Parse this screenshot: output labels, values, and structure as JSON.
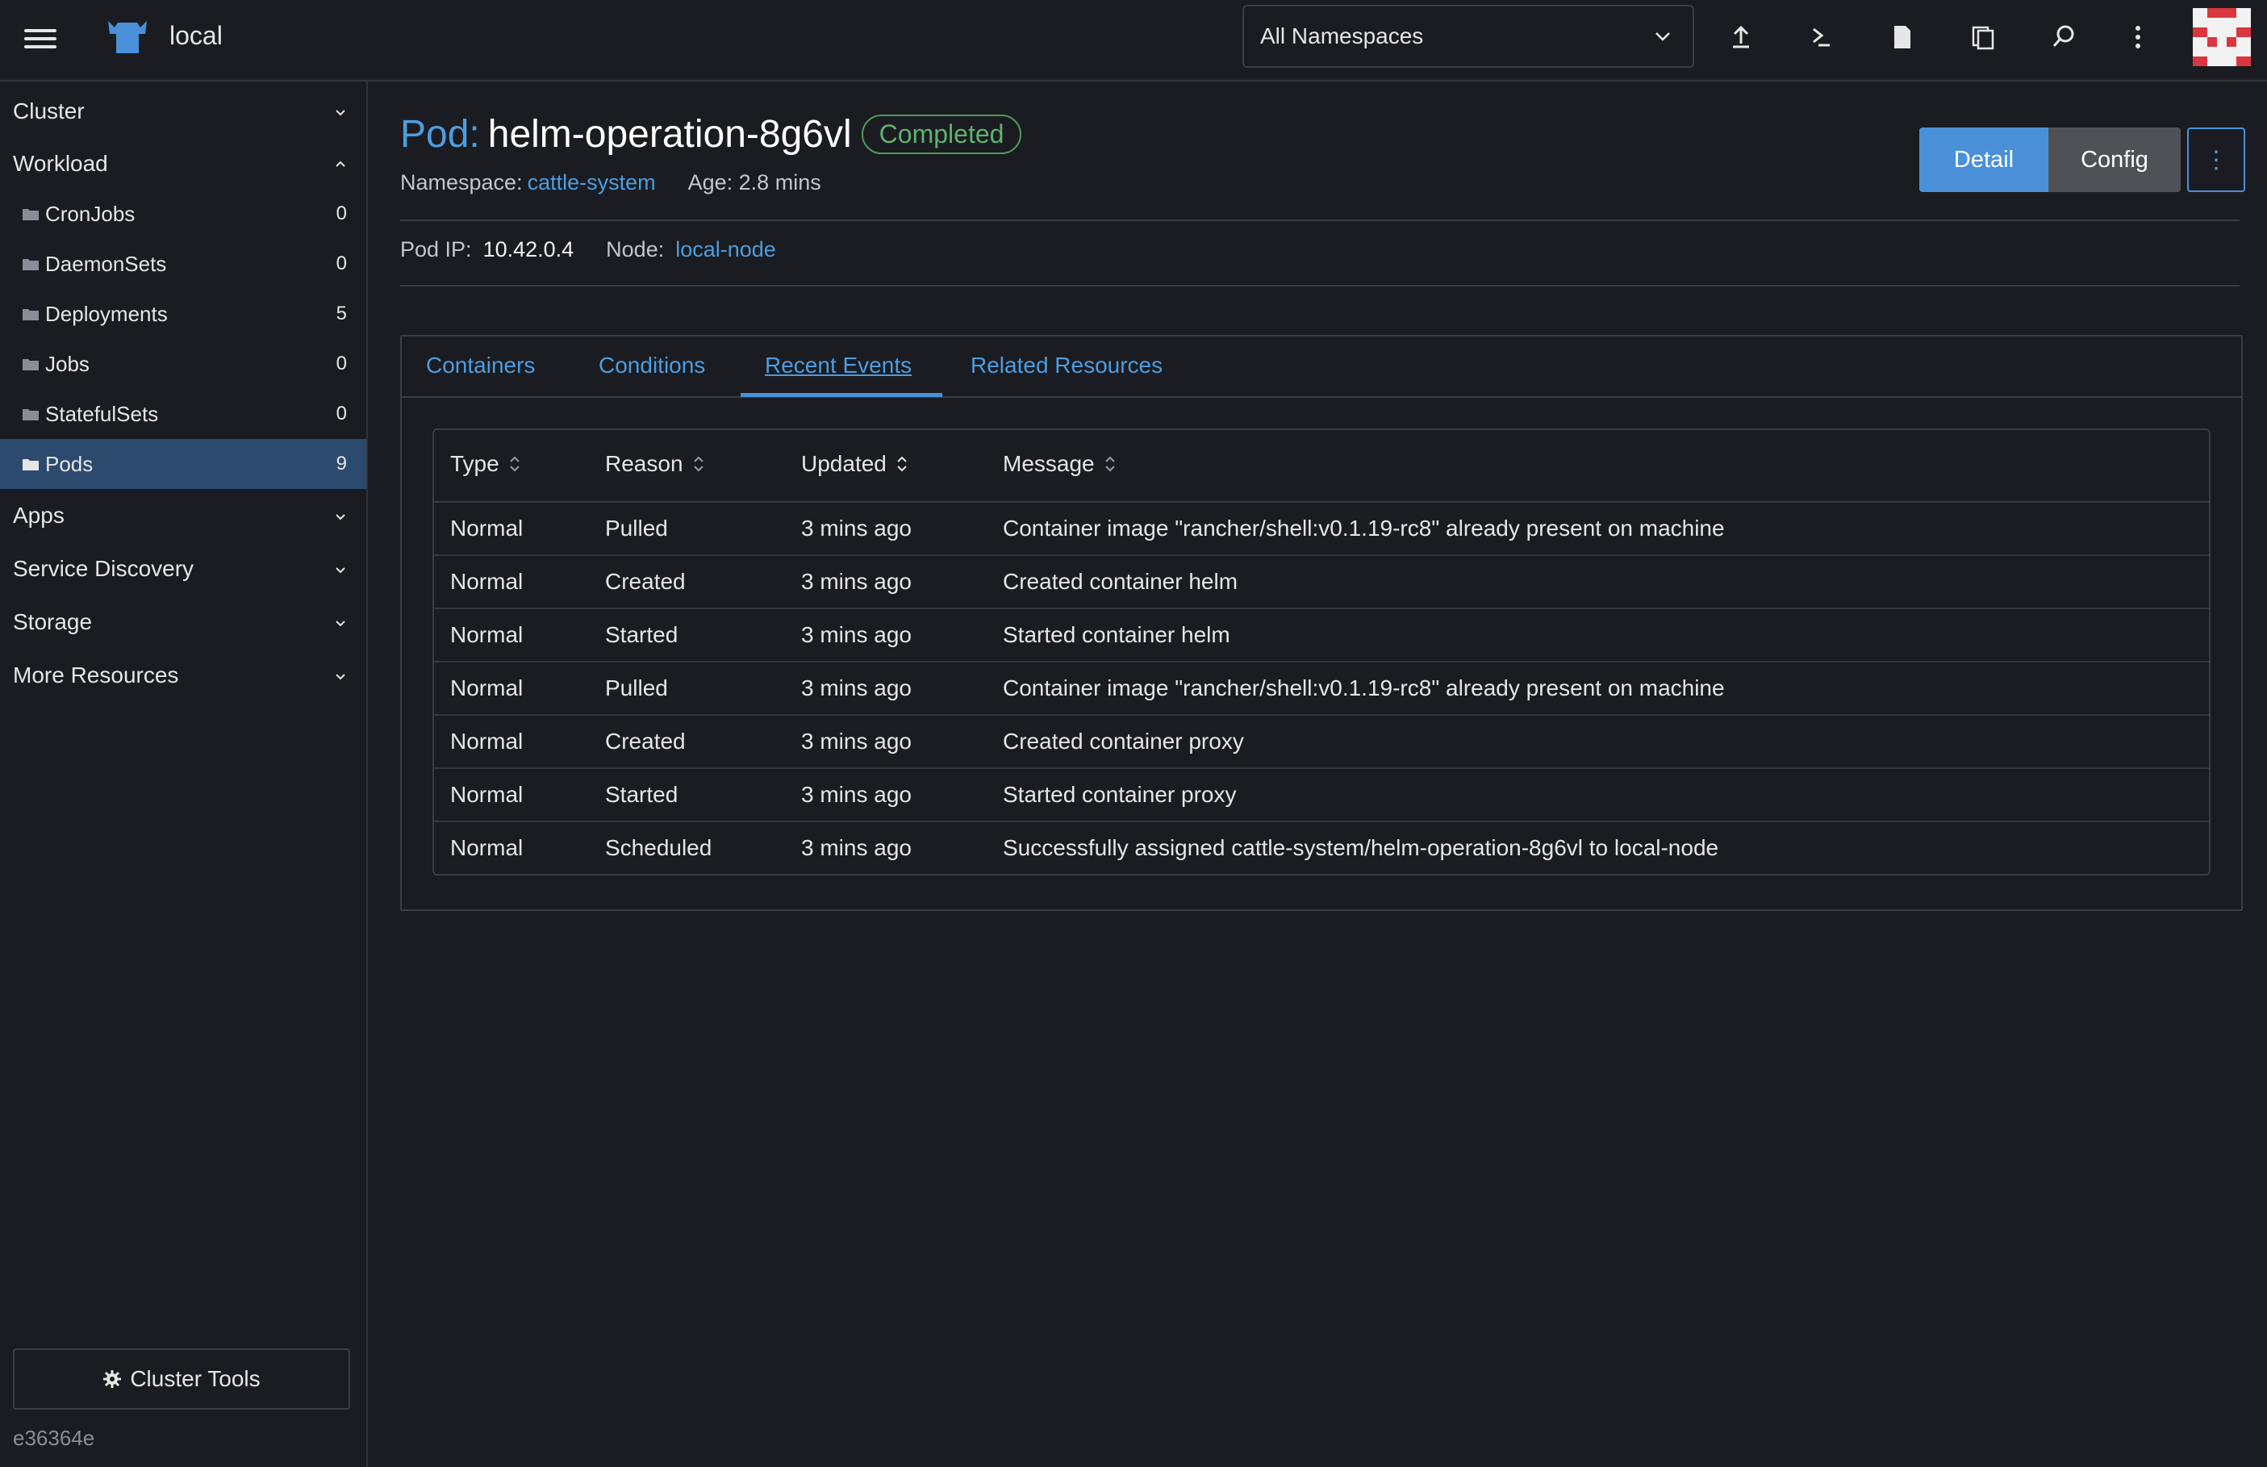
{
  "header": {
    "cluster_name": "local",
    "namespace_select": "All Namespaces",
    "icons": [
      "upload-icon",
      "terminal-icon",
      "file-icon",
      "copy-icon",
      "search-icon",
      "more-vertical-icon"
    ]
  },
  "sidebar": {
    "groups": {
      "cluster": "Cluster",
      "workload": "Workload",
      "apps": "Apps",
      "service_discovery": "Service Discovery",
      "storage": "Storage",
      "more_resources": "More Resources"
    },
    "workload_items": [
      {
        "label": "CronJobs",
        "count": "0"
      },
      {
        "label": "DaemonSets",
        "count": "0"
      },
      {
        "label": "Deployments",
        "count": "5"
      },
      {
        "label": "Jobs",
        "count": "0"
      },
      {
        "label": "StatefulSets",
        "count": "0"
      },
      {
        "label": "Pods",
        "count": "9"
      }
    ],
    "active_item": "Pods",
    "cluster_tools": "Cluster Tools",
    "version": "e36364e"
  },
  "page": {
    "type_label": "Pod:",
    "name": "helm-operation-8g6vl",
    "status": "Completed",
    "namespace_label": "Namespace:",
    "namespace": "cattle-system",
    "age": "Age: 2.8 mins",
    "pod_ip_label": "Pod IP:",
    "pod_ip": "10.42.0.4",
    "node_label": "Node:",
    "node": "local-node",
    "buttons": {
      "detail": "Detail",
      "config": "Config",
      "more": "⋮"
    }
  },
  "tabs": [
    {
      "label": "Containers"
    },
    {
      "label": "Conditions"
    },
    {
      "label": "Recent Events"
    },
    {
      "label": "Related Resources"
    }
  ],
  "active_tab": "Recent Events",
  "events": {
    "columns": [
      "Type",
      "Reason",
      "Updated",
      "Message"
    ],
    "rows": [
      {
        "type": "Normal",
        "reason": "Pulled",
        "updated": "3 mins ago",
        "message": "Container image \"rancher/shell:v0.1.19-rc8\" already present on machine"
      },
      {
        "type": "Normal",
        "reason": "Created",
        "updated": "3 mins ago",
        "message": "Created container helm"
      },
      {
        "type": "Normal",
        "reason": "Started",
        "updated": "3 mins ago",
        "message": "Started container helm"
      },
      {
        "type": "Normal",
        "reason": "Pulled",
        "updated": "3 mins ago",
        "message": "Container image \"rancher/shell:v0.1.19-rc8\" already present on machine"
      },
      {
        "type": "Normal",
        "reason": "Created",
        "updated": "3 mins ago",
        "message": "Created container proxy"
      },
      {
        "type": "Normal",
        "reason": "Started",
        "updated": "3 mins ago",
        "message": "Started container proxy"
      },
      {
        "type": "Normal",
        "reason": "Scheduled",
        "updated": "3 mins ago",
        "message": "Successfully assigned cattle-system/helm-operation-8g6vl to local-node"
      }
    ]
  },
  "colors": {
    "background": "#1b1c21",
    "accent": "#4d9de0",
    "active_nav": "#2b4a6e",
    "status_completed": "#5eb36d",
    "primary_button": "#4a90d9"
  }
}
